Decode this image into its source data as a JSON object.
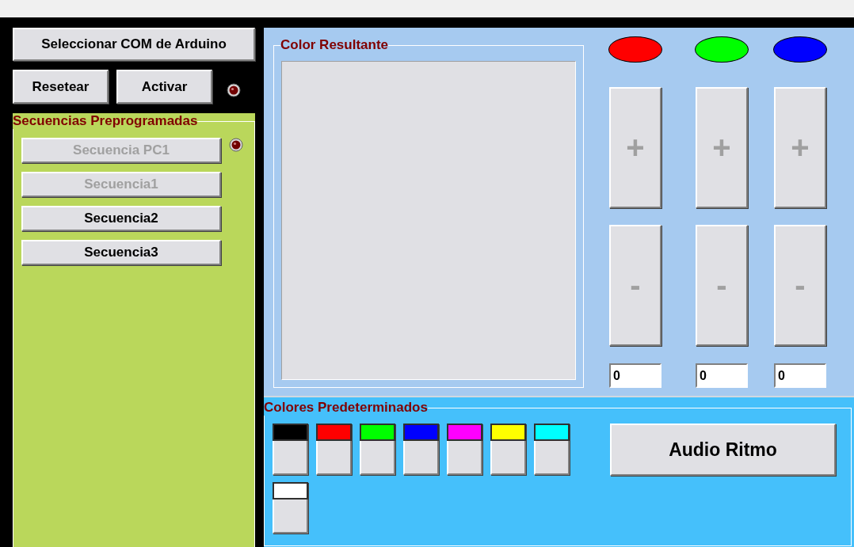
{
  "connection": {
    "select_port_button": "Seleccionar COM de Arduino",
    "reset_button": "Resetear",
    "activate_button": "Activar"
  },
  "sequences": {
    "title": "Secuencias Preprogramadas",
    "items": [
      {
        "label": "Secuencia PC1",
        "disabled": true
      },
      {
        "label": "Secuencia1",
        "disabled": true
      },
      {
        "label": "Secuencia2",
        "disabled": false
      },
      {
        "label": "Secuencia3",
        "disabled": false
      }
    ]
  },
  "result": {
    "title": "Color Resultante"
  },
  "channels": [
    {
      "color": "#ff0000",
      "increment": {
        "label": "+",
        "disabled": true
      },
      "decrement": {
        "label": "-",
        "disabled": true
      },
      "value": "0"
    },
    {
      "color": "#00ff00",
      "increment": {
        "label": "+",
        "disabled": true
      },
      "decrement": {
        "label": "-",
        "disabled": true
      },
      "value": "0"
    },
    {
      "color": "#0000ff",
      "increment": {
        "label": "+",
        "disabled": true
      },
      "decrement": {
        "label": "-",
        "disabled": true
      },
      "value": "0"
    }
  ],
  "presets": {
    "title": "Colores Predeterminados",
    "swatches": [
      {
        "color": "#000000"
      },
      {
        "color": "#ff0000"
      },
      {
        "color": "#00ff00"
      },
      {
        "color": "#0000ff"
      },
      {
        "color": "#ff00ff"
      },
      {
        "color": "#ffff00"
      },
      {
        "color": "#00ffff"
      },
      {
        "color": "#ffffff"
      }
    ],
    "audio_button": "Audio Ritmo"
  }
}
